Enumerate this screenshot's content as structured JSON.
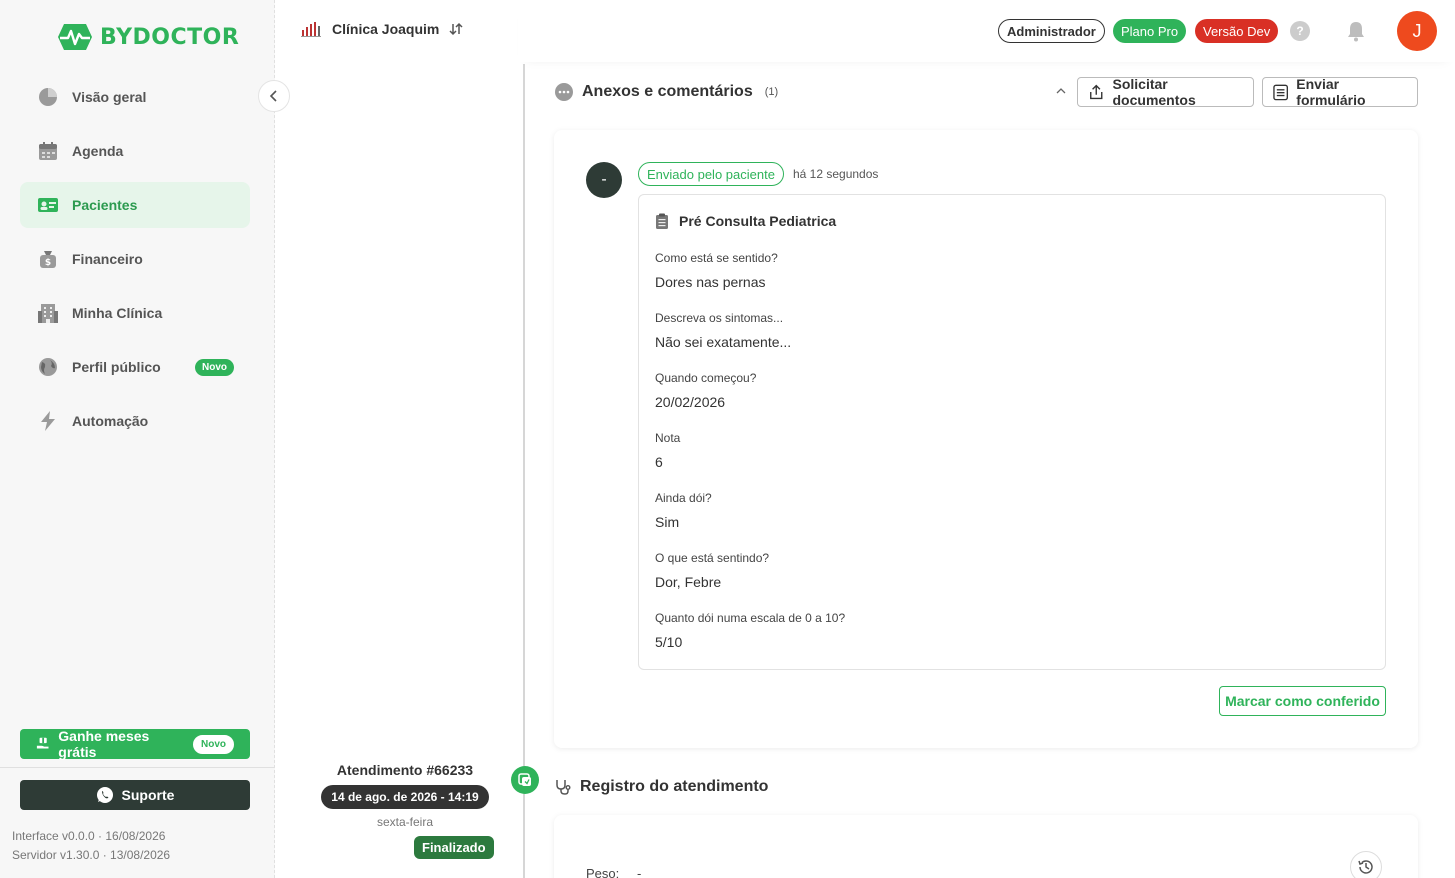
{
  "brand": {
    "name": "BYDOCTOR"
  },
  "sidebar": {
    "items": [
      {
        "label": "Visão geral",
        "icon": "pie-chart-icon"
      },
      {
        "label": "Agenda",
        "icon": "calendar-icon"
      },
      {
        "label": "Pacientes",
        "icon": "id-card-icon",
        "active": true
      },
      {
        "label": "Financeiro",
        "icon": "money-bag-icon"
      },
      {
        "label": "Minha Clínica",
        "icon": "building-icon"
      },
      {
        "label": "Perfil público",
        "icon": "globe-icon",
        "badge": "Novo"
      },
      {
        "label": "Automação",
        "icon": "lightning-icon"
      }
    ],
    "promo": {
      "label": "Ganhe meses grátis",
      "badge": "Novo"
    },
    "support": {
      "label": "Suporte"
    },
    "version_interface": "Interface v0.0.0 · 16/08/2026",
    "version_server": "Servidor v1.30.0 · 13/08/2026"
  },
  "clinic": {
    "name": "Clínica Joaquim"
  },
  "header": {
    "role": "Administrador",
    "plan": "Plano Pro",
    "version": "Versão Dev",
    "help": "?",
    "avatar_initial": "J"
  },
  "attachments": {
    "title": "Anexos e comentários",
    "count": "(1)",
    "request_docs_label": "Solicitar documentos",
    "send_form_label": "Enviar formulário"
  },
  "comment": {
    "author_initial": "-",
    "sent_by": "Enviado pelo paciente",
    "time_ago": "há 12 segundos",
    "form_title": "Pré Consulta Pediatrica",
    "qa": [
      {
        "q": "Como está se sentido?",
        "a": "Dores nas pernas"
      },
      {
        "q": "Descreva os sintomas...",
        "a": "Não sei exatamente..."
      },
      {
        "q": "Quando começou?",
        "a": "20/02/2026"
      },
      {
        "q": "Nota",
        "a": "6"
      },
      {
        "q": "Ainda dói?",
        "a": "Sim"
      },
      {
        "q": "O que está sentindo?",
        "a": "Dor, Febre"
      },
      {
        "q": "Quanto dói numa escala de 0 a 10?",
        "a": "5/10"
      }
    ],
    "mark_checked_label": "Marcar como conferido"
  },
  "appointment": {
    "title": "Atendimento #66233",
    "date": "14 de ago. de 2026 - 14:19",
    "weekday": "sexta-feira",
    "status": "Finalizado"
  },
  "record": {
    "title": "Registro do atendimento",
    "weight_label": "Peso:",
    "weight_value": "-"
  },
  "colors": {
    "accent": "#2fb35a",
    "danger": "#d93025",
    "avatar": "#ee4a1e",
    "dark": "#2e3b36"
  }
}
